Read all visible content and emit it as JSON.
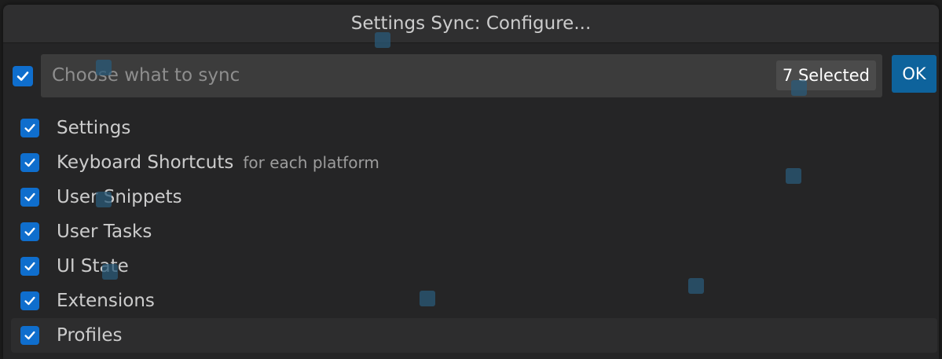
{
  "window": {
    "title": "Settings Sync: Configure..."
  },
  "input": {
    "placeholder": "Choose what to sync",
    "selected_count": "7 Selected",
    "ok_label": "OK"
  },
  "items": [
    {
      "label": "Settings",
      "description": "",
      "checked": true
    },
    {
      "label": "Keyboard Shortcuts",
      "description": "for each platform",
      "checked": true
    },
    {
      "label": "User Snippets",
      "description": "",
      "checked": true
    },
    {
      "label": "User Tasks",
      "description": "",
      "checked": true
    },
    {
      "label": "UI State",
      "description": "",
      "checked": true
    },
    {
      "label": "Extensions",
      "description": "",
      "checked": true
    },
    {
      "label": "Profiles",
      "description": "",
      "checked": true
    }
  ],
  "colors": {
    "accent": "#0f6ecd",
    "button": "#0e639c",
    "background": "#252526",
    "input": "#3c3c3c"
  },
  "icons": {
    "checkbox": "checkmark-icon"
  }
}
